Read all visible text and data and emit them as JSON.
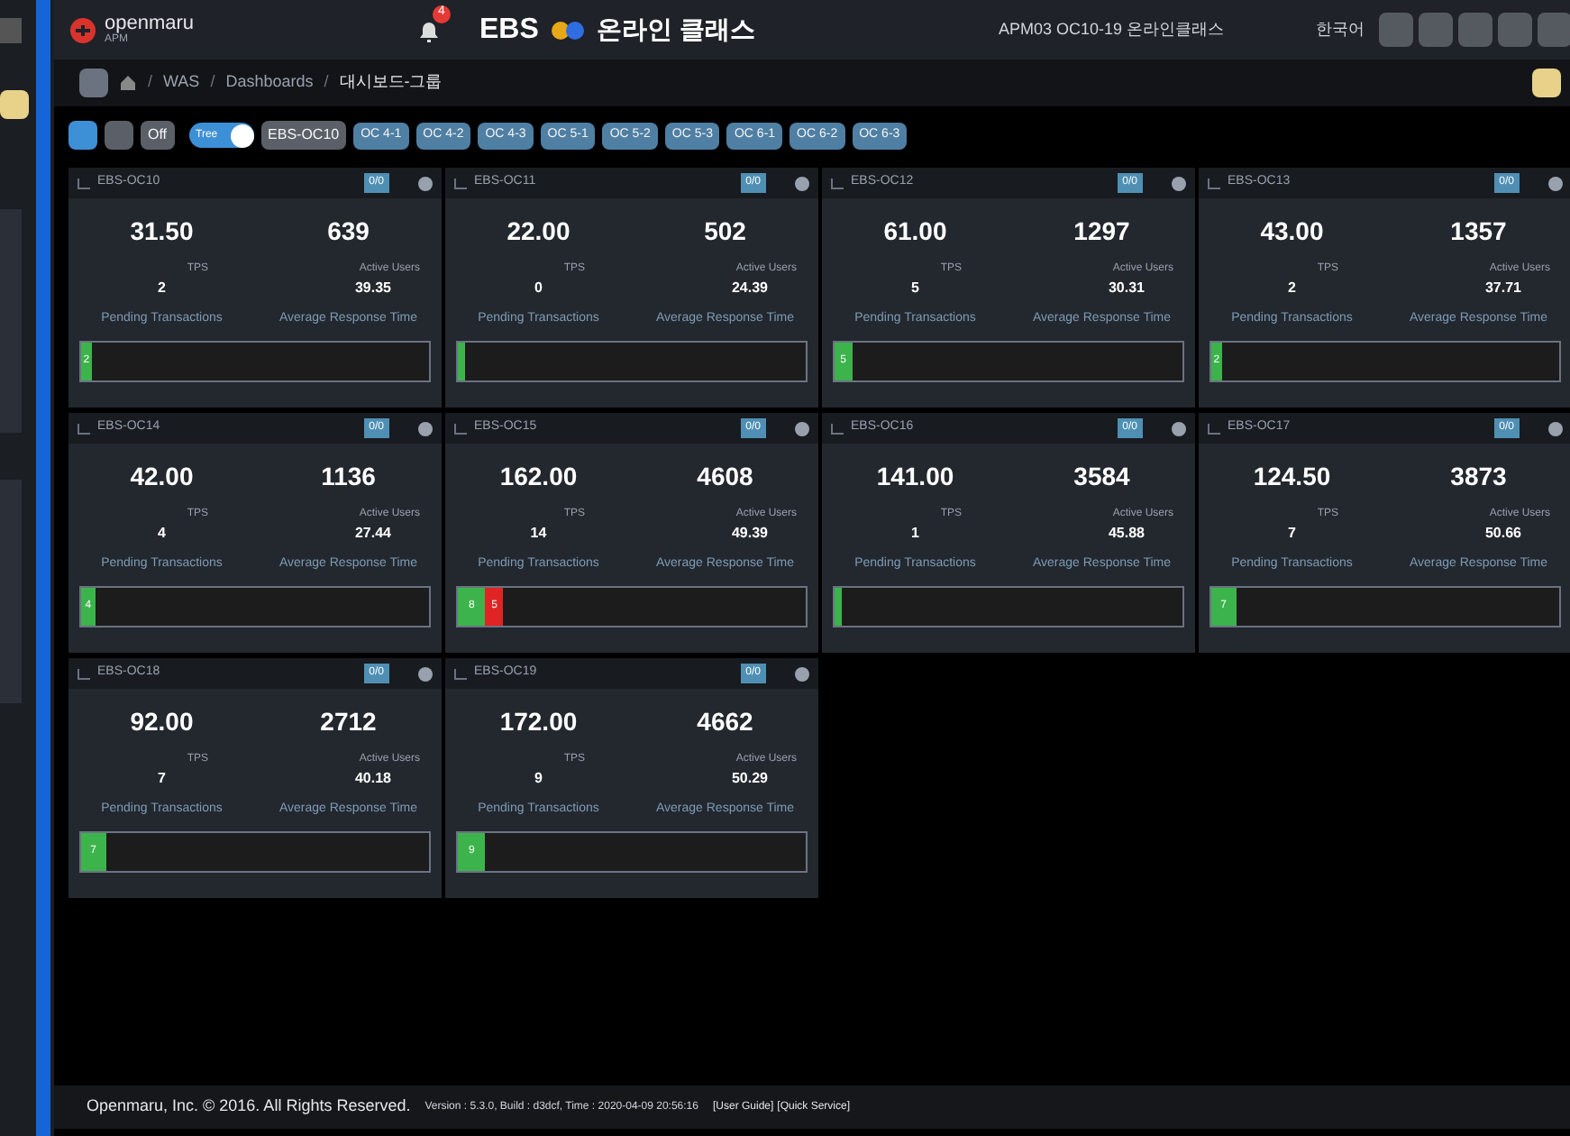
{
  "header": {
    "logo_name": "openmaru",
    "logo_sub": "APM",
    "alert_count": "4",
    "brand": "EBS",
    "brand_title": "온라인 클래스",
    "instance": "APM03 OC10-19 온라인클래스",
    "language": "한국어"
  },
  "breadcrumb": {
    "separator": "/",
    "items": [
      "WAS",
      "Dashboards",
      "대시보드-그룹"
    ]
  },
  "toolbar": {
    "refresh": "Off",
    "tree_label": "Tree",
    "tree_on": true,
    "server": "EBS-OC10",
    "tags": [
      "OC 4-1",
      "OC 4-2",
      "OC 4-3",
      "OC 5-1",
      "OC 5-2",
      "OC 5-3",
      "OC 6-1",
      "OC 6-2",
      "OC 6-3"
    ]
  },
  "cards": [
    {
      "title": "EBS-OC10",
      "badge": "0/0",
      "value_1": "31.50",
      "value_2": "639",
      "label_1": "TPS",
      "label_2": "Active Users",
      "stat_1": "2",
      "stat_2": "39.35",
      "caption_1": "Pending Transactions",
      "caption_2": "Average Response Time",
      "segments": [
        {
          "label": "2",
          "level": 0.03,
          "color": "#3cb44b"
        }
      ]
    },
    {
      "title": "EBS-OC11",
      "badge": "0/0",
      "value_1": "22.00",
      "value_2": "502",
      "label_1": "TPS",
      "label_2": "Active Users",
      "stat_1": "0",
      "stat_2": "24.39",
      "caption_1": "Pending Transactions",
      "caption_2": "Average Response Time",
      "segments": [
        {
          "level": 0.02,
          "color": "#3cb44b"
        }
      ]
    },
    {
      "title": "EBS-OC12",
      "badge": "0/0",
      "value_1": "61.00",
      "value_2": "1297",
      "label_1": "TPS",
      "label_2": "Active Users",
      "stat_1": "5",
      "stat_2": "30.31",
      "caption_1": "Pending Transactions",
      "caption_2": "Average Response Time",
      "segments": [
        {
          "label": "5",
          "level": 0.05,
          "color": "#3cb44b"
        }
      ]
    },
    {
      "title": "EBS-OC13",
      "badge": "0/0",
      "value_1": "43.00",
      "value_2": "1357",
      "label_1": "TPS",
      "label_2": "Active Users",
      "stat_1": "2",
      "stat_2": "37.71",
      "caption_1": "Pending Transactions",
      "caption_2": "Average Response Time",
      "segments": [
        {
          "label": "2",
          "level": 0.03,
          "color": "#3cb44b"
        }
      ]
    },
    {
      "title": "EBS-OC14",
      "badge": "0/0",
      "value_1": "42.00",
      "value_2": "1136",
      "label_1": "TPS",
      "label_2": "Active Users",
      "stat_1": "4",
      "stat_2": "27.44",
      "caption_1": "Pending Transactions",
      "caption_2": "Average Response Time",
      "segments": [
        {
          "label": "4",
          "level": 0.04,
          "color": "#3cb44b"
        }
      ]
    },
    {
      "title": "EBS-OC15",
      "badge": "0/0",
      "value_1": "162.00",
      "value_2": "4608",
      "label_1": "TPS",
      "label_2": "Active Users",
      "stat_1": "14",
      "stat_2": "49.39",
      "caption_1": "Pending Transactions",
      "caption_2": "Average Response Time",
      "segments": [
        {
          "label": "8",
          "level": 0.08,
          "color": "#3cb44b"
        },
        {
          "label": "5",
          "level": 0.05,
          "color": "#e02424"
        }
      ]
    },
    {
      "title": "EBS-OC16",
      "badge": "0/0",
      "value_1": "141.00",
      "value_2": "3584",
      "label_1": "TPS",
      "label_2": "Active Users",
      "stat_1": "1",
      "stat_2": "45.88",
      "caption_1": "Pending Transactions",
      "caption_2": "Average Response Time",
      "segments": [
        {
          "level": 0.02,
          "color": "#3cb44b"
        }
      ]
    },
    {
      "title": "EBS-OC17",
      "badge": "0/0",
      "value_1": "124.50",
      "value_2": "3873",
      "label_1": "TPS",
      "label_2": "Active Users",
      "stat_1": "7",
      "stat_2": "50.66",
      "caption_1": "Pending Transactions",
      "caption_2": "Average Response Time",
      "segments": [
        {
          "label": "7",
          "level": 0.07,
          "color": "#3cb44b"
        }
      ]
    },
    {
      "title": "EBS-OC18",
      "badge": "0/0",
      "value_1": "92.00",
      "value_2": "2712",
      "label_1": "TPS",
      "label_2": "Active Users",
      "stat_1": "7",
      "stat_2": "40.18",
      "caption_1": "Pending Transactions",
      "caption_2": "Average Response Time",
      "segments": [
        {
          "label": "7",
          "level": 0.07,
          "color": "#3cb44b"
        }
      ]
    },
    {
      "title": "EBS-OC19",
      "badge": "0/0",
      "value_1": "172.00",
      "value_2": "4662",
      "label_1": "TPS",
      "label_2": "Active Users",
      "stat_1": "9",
      "stat_2": "50.29",
      "caption_1": "Pending Transactions",
      "caption_2": "Average Response Time",
      "segments": [
        {
          "label": "9",
          "level": 0.08,
          "color": "#3cb44b"
        }
      ]
    }
  ],
  "footer": {
    "copyright": "Openmaru, Inc. © 2016. All Rights Reserved.",
    "version": "Version : 5.3.0, Build : d3dcf, Time : 2020-04-09 20:56:16",
    "links": [
      "[User Guide]",
      "[Quick Service]"
    ]
  }
}
